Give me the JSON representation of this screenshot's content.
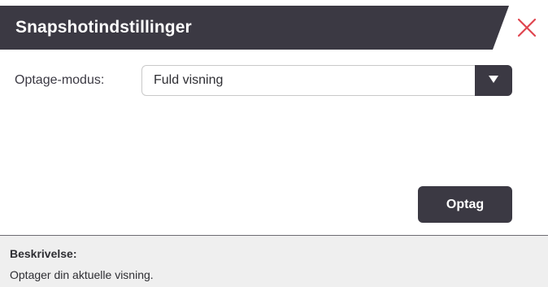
{
  "dialog": {
    "title": "Snapshotindstillinger",
    "close_icon": "close-icon",
    "close_color": "#e0454f"
  },
  "mode": {
    "label": "Optage-modus:",
    "selected": "Fuld visning",
    "arrow_icon": "triangle-down-icon"
  },
  "actions": {
    "record_label": "Optag"
  },
  "description": {
    "label": "Beskrivelse:",
    "text": "Optager din aktuelle visning."
  },
  "colors": {
    "header_bg": "#3b3943",
    "panel_bg": "#efefef",
    "accent_close": "#e0454f"
  }
}
